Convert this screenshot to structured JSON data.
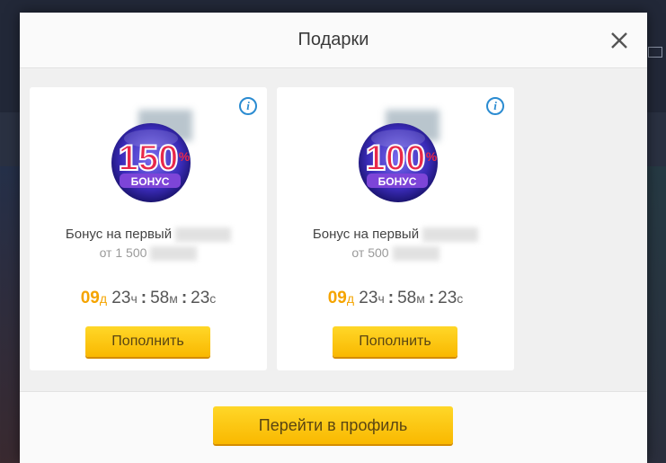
{
  "modal": {
    "title": "Подарки",
    "footer_button": "Перейти в профиль"
  },
  "cards": [
    {
      "badge_percent": "150",
      "badge_symbol": "%",
      "badge_word": "БОНУС",
      "title": "Бонус на первый",
      "subtitle": "от 1 500",
      "timer": {
        "days": "09",
        "days_unit": "д",
        "hours": "23",
        "hours_unit": "ч",
        "minutes": "58",
        "minutes_unit": "м",
        "seconds": "23",
        "seconds_unit": "с"
      },
      "button": "Пополнить"
    },
    {
      "badge_percent": "100",
      "badge_symbol": "%",
      "badge_word": "БОНУС",
      "title": "Бонус на первый",
      "subtitle": "от 500",
      "timer": {
        "days": "09",
        "days_unit": "д",
        "hours": "23",
        "hours_unit": "ч",
        "minutes": "58",
        "minutes_unit": "м",
        "seconds": "23",
        "seconds_unit": "с"
      },
      "button": "Пополнить"
    }
  ],
  "colors": {
    "accent_yellow": "#f9b800",
    "timer_days": "#f5a400",
    "info_blue": "#2a8bd1",
    "badge_red": "#e8284a"
  },
  "icons": {
    "close": "close-icon",
    "info": "info-icon"
  }
}
